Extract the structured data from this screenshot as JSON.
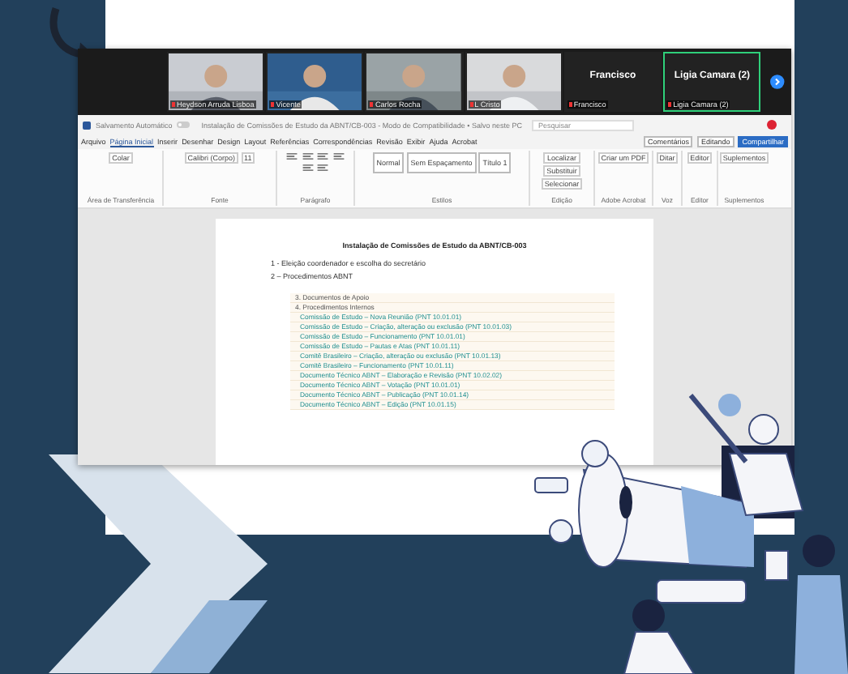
{
  "meeting": {
    "participants": [
      {
        "kind": "video",
        "name": "Heydson Arruda Lisboa",
        "speaking": false
      },
      {
        "kind": "video",
        "name": "Vicente",
        "speaking": false
      },
      {
        "kind": "video",
        "name": "Carlos Rocha",
        "speaking": false
      },
      {
        "kind": "video",
        "name": "L Cristo",
        "speaking": false
      },
      {
        "kind": "name",
        "title": "Francisco",
        "name": "Francisco",
        "speaking": false
      },
      {
        "kind": "name",
        "title": "Ligia Camara (2)",
        "name": "Ligia Camara (2)",
        "speaking": true
      }
    ]
  },
  "word": {
    "autosave": "Salvamento Automático",
    "autosave_on": false,
    "document_title": "Instalação de Comissões de Estudo da ABNT/CB-003 - Modo de Compatibilidade • Salvo neste PC",
    "search": {
      "placeholder": "Pesquisar"
    },
    "menu": [
      {
        "label": "Arquivo",
        "selected": false
      },
      {
        "label": "Página Inicial",
        "selected": true
      },
      {
        "label": "Inserir",
        "selected": false
      },
      {
        "label": "Desenhar",
        "selected": false
      },
      {
        "label": "Design",
        "selected": false
      },
      {
        "label": "Layout",
        "selected": false
      },
      {
        "label": "Referências",
        "selected": false
      },
      {
        "label": "Correspondências",
        "selected": false
      },
      {
        "label": "Revisão",
        "selected": false
      },
      {
        "label": "Exibir",
        "selected": false
      },
      {
        "label": "Ajuda",
        "selected": false
      },
      {
        "label": "Acrobat",
        "selected": false
      }
    ],
    "actions": {
      "comments": "Comentários",
      "editing": "Editando",
      "share": "Compartilhar"
    },
    "ribbon": [
      {
        "label": "Área de Transferência",
        "items": [
          "Colar"
        ]
      },
      {
        "label": "Fonte",
        "items": [
          "Calibri (Corpo)",
          "11"
        ]
      },
      {
        "label": "Parágrafo"
      },
      {
        "label": "Estilos",
        "items": [
          "Normal",
          "Sem Espaçamento",
          "Título 1"
        ]
      },
      {
        "label": "Edição",
        "items": [
          "Localizar",
          "Substituir",
          "Selecionar"
        ]
      },
      {
        "label": "Adobe Acrobat",
        "items": [
          "Criar um PDF"
        ]
      },
      {
        "label": "Voz",
        "items": [
          "Ditar"
        ]
      },
      {
        "label": "Editor",
        "items": [
          "Editor"
        ]
      },
      {
        "label": "Suplementos",
        "items": [
          "Suplementos"
        ]
      }
    ]
  },
  "document": {
    "title": "Instalação de Comissões de Estudo da ABNT/CB-003",
    "items": [
      "1 - Eleição coordenador e escolha do secretário",
      "2 – Procedimentos ABNT"
    ],
    "tree": {
      "headers": [
        "3. Documentos de Apoio",
        "4. Procedimentos Internos"
      ],
      "links": [
        "Comissão de Estudo – Nova Reunião (PNT 10.01.01)",
        "Comissão de Estudo – Criação, alteração ou exclusão (PNT 10.01.03)",
        "Comissão de Estudo – Funcionamento (PNT 10.01.01)",
        "Comissão de Estudo – Pautas e Atas (PNT 10.01.11)",
        "Comitê Brasileiro – Criação, alteração ou exclusão (PNT 10.01.13)",
        "Comitê Brasileiro – Funcionamento (PNT 10.01.11)",
        "Documento Técnico ABNT – Elaboração e Revisão (PNT 10.02.02)",
        "Documento Técnico ABNT – Votação (PNT 10.01.01)",
        "Documento Técnico ABNT – Publicação (PNT 10.01.14)",
        "Documento Técnico ABNT – Edição (PNT 10.01.15)"
      ]
    }
  }
}
